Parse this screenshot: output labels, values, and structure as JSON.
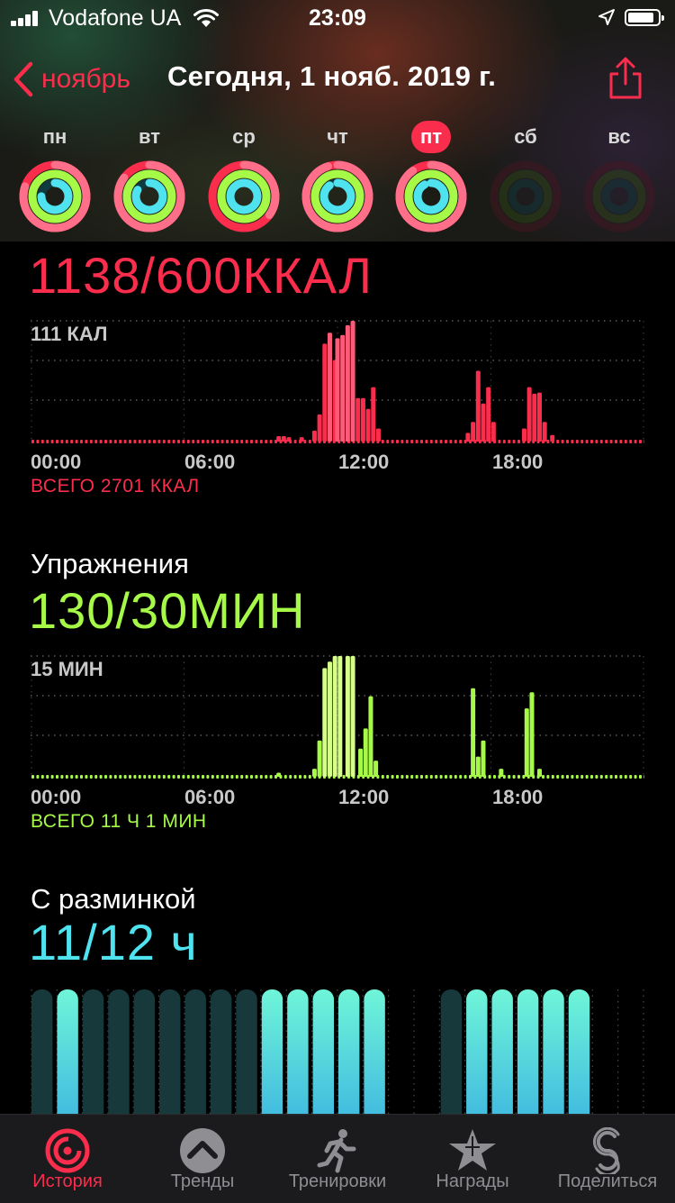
{
  "status_bar": {
    "carrier": "Vodafone UA",
    "time": "23:09"
  },
  "nav": {
    "back_label": "ноябрь",
    "title": "Сегодня, 1 нояб. 2019 г."
  },
  "week": [
    {
      "label": "пн",
      "today": false,
      "move": 1.8,
      "exercise": 1.0,
      "stand": 0.75,
      "dim": false
    },
    {
      "label": "вт",
      "today": false,
      "move": 1.85,
      "exercise": 1.0,
      "stand": 0.83,
      "dim": false
    },
    {
      "label": "ср",
      "today": false,
      "move": 1.35,
      "exercise": 1.0,
      "stand": 1.0,
      "dim": false
    },
    {
      "label": "чт",
      "today": false,
      "move": 1.95,
      "exercise": 1.0,
      "stand": 0.9,
      "dim": false
    },
    {
      "label": "пт",
      "today": true,
      "move": 1.9,
      "exercise": 1.0,
      "stand": 0.92,
      "dim": false
    },
    {
      "label": "сб",
      "today": false,
      "move": 0,
      "exercise": 0,
      "stand": 0,
      "dim": true
    },
    {
      "label": "вс",
      "today": false,
      "move": 0,
      "exercise": 0,
      "stand": 0,
      "dim": true
    }
  ],
  "move": {
    "value": "1138/600ККАЛ",
    "max_label": "111 КАЛ",
    "total": "ВСЕГО 2701 ККАЛ"
  },
  "exercise": {
    "title": "Упражнения",
    "value": "130/30МИН",
    "max_label": "15 МИН",
    "total": "ВСЕГО 11 Ч 1 МИН"
  },
  "stand": {
    "title": "С разминкой",
    "value": "11/12 ч"
  },
  "x_ticks": [
    "00:00",
    "06:00",
    "12:00",
    "18:00"
  ],
  "colors": {
    "move": "#fa2d4d",
    "move_light": "#ff5a78",
    "exercise": "#a6f947",
    "exercise_light": "#d6ff8a",
    "stand": "#4fe3ef",
    "stand_dim": "#17393c",
    "accent": "#fa2d4d"
  },
  "chart_data": [
    {
      "type": "bar",
      "name": "move",
      "unit": "КАЛ",
      "xlabel": "",
      "ylabel": "",
      "x_range_hours": [
        0,
        24
      ],
      "ymax": 111,
      "bars": [
        {
          "h": 9.7,
          "v": 5
        },
        {
          "h": 9.9,
          "v": 5
        },
        {
          "h": 10.1,
          "v": 4
        },
        {
          "h": 10.6,
          "v": 4
        },
        {
          "h": 11.1,
          "v": 10
        },
        {
          "h": 11.3,
          "v": 25
        },
        {
          "h": 11.5,
          "v": 90
        },
        {
          "h": 11.7,
          "v": 100
        },
        {
          "h": 11.9,
          "v": 75
        },
        {
          "h": 12.0,
          "v": 95
        },
        {
          "h": 12.2,
          "v": 98
        },
        {
          "h": 12.4,
          "v": 107
        },
        {
          "h": 12.6,
          "v": 111
        },
        {
          "h": 12.8,
          "v": 40
        },
        {
          "h": 13.0,
          "v": 40
        },
        {
          "h": 13.2,
          "v": 30
        },
        {
          "h": 13.4,
          "v": 50
        },
        {
          "h": 13.6,
          "v": 12
        },
        {
          "h": 17.1,
          "v": 8
        },
        {
          "h": 17.3,
          "v": 18
        },
        {
          "h": 17.5,
          "v": 65
        },
        {
          "h": 17.7,
          "v": 35
        },
        {
          "h": 17.9,
          "v": 50
        },
        {
          "h": 18.1,
          "v": 18
        },
        {
          "h": 19.3,
          "v": 12
        },
        {
          "h": 19.5,
          "v": 50
        },
        {
          "h": 19.7,
          "v": 44
        },
        {
          "h": 19.9,
          "v": 45
        },
        {
          "h": 20.1,
          "v": 18
        },
        {
          "h": 20.4,
          "v": 6
        }
      ]
    },
    {
      "type": "bar",
      "name": "exercise",
      "unit": "МИН",
      "xlabel": "",
      "ylabel": "",
      "x_range_hours": [
        0,
        24
      ],
      "ymax": 15,
      "bars": [
        {
          "h": 9.7,
          "v": 0.5
        },
        {
          "h": 11.1,
          "v": 1
        },
        {
          "h": 11.3,
          "v": 4.5
        },
        {
          "h": 11.5,
          "v": 13.5
        },
        {
          "h": 11.7,
          "v": 14.3
        },
        {
          "h": 11.9,
          "v": 15
        },
        {
          "h": 12.1,
          "v": 15
        },
        {
          "h": 12.4,
          "v": 15
        },
        {
          "h": 12.6,
          "v": 15
        },
        {
          "h": 12.9,
          "v": 3.5
        },
        {
          "h": 13.1,
          "v": 6
        },
        {
          "h": 13.3,
          "v": 10
        },
        {
          "h": 13.5,
          "v": 2
        },
        {
          "h": 17.3,
          "v": 11
        },
        {
          "h": 17.5,
          "v": 2.5
        },
        {
          "h": 17.7,
          "v": 4.5
        },
        {
          "h": 18.4,
          "v": 1
        },
        {
          "h": 19.4,
          "v": 8.5
        },
        {
          "h": 19.6,
          "v": 10.5
        },
        {
          "h": 19.9,
          "v": 1
        }
      ]
    },
    {
      "type": "bar",
      "name": "stand",
      "x_range_hours": [
        0,
        24
      ],
      "hours": [
        {
          "h": 0,
          "stood": false
        },
        {
          "h": 1,
          "stood": true
        },
        {
          "h": 2,
          "stood": false
        },
        {
          "h": 3,
          "stood": false
        },
        {
          "h": 4,
          "stood": false
        },
        {
          "h": 5,
          "stood": false
        },
        {
          "h": 6,
          "stood": false
        },
        {
          "h": 7,
          "stood": false
        },
        {
          "h": 8,
          "stood": false
        },
        {
          "h": 9,
          "stood": true
        },
        {
          "h": 10,
          "stood": true
        },
        {
          "h": 11,
          "stood": true
        },
        {
          "h": 12,
          "stood": true
        },
        {
          "h": 13,
          "stood": true
        },
        {
          "h": 16,
          "stood": false
        },
        {
          "h": 17,
          "stood": true
        },
        {
          "h": 18,
          "stood": true
        },
        {
          "h": 19,
          "stood": true
        },
        {
          "h": 20,
          "stood": true
        },
        {
          "h": 21,
          "stood": true
        }
      ]
    }
  ],
  "tabs": [
    {
      "label": "История",
      "icon": "rings-history-icon",
      "active": true
    },
    {
      "label": "Тренды",
      "icon": "trends-chevron-icon",
      "active": false
    },
    {
      "label": "Тренировки",
      "icon": "running-figure-icon",
      "active": false
    },
    {
      "label": "Награды",
      "icon": "award-star-icon",
      "active": false
    },
    {
      "label": "Поделиться",
      "icon": "sharing-icon",
      "active": false
    }
  ]
}
